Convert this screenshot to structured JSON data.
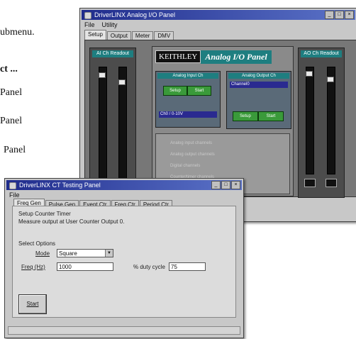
{
  "document": {
    "lines": [
      "ubmenu.",
      "ct ...",
      "Panel",
      "Panel",
      "Panel"
    ]
  },
  "analog_window": {
    "title": "DriverLINX Analog I/O Panel",
    "menu": [
      "File",
      "Utility"
    ],
    "tabs": [
      "Setup",
      "Output",
      "Meter",
      "DMV"
    ],
    "left_panel_header": "AI Ch Readout",
    "right_panel_header": "AO Ch Readout",
    "brand": "KEITHLEY",
    "panel_name": "Analog I/O Panel",
    "input_box_header": "Analog Input Ch",
    "output_box_header": "Analog Output Ch",
    "input_select": "Ch0 / 0-10V",
    "output_select": "Channel0",
    "input_button_1": "Setup",
    "input_button_2": "Start",
    "output_button_1": "Setup",
    "output_button_2": "Start",
    "lower_notes": [
      "Analog input channels",
      "Analog output channels",
      "Digital channels",
      "Counter/timer channels"
    ]
  },
  "counter_window": {
    "title": "DriverLINX CT Testing Panel",
    "menu": [
      "File"
    ],
    "tabs": [
      "Freq Gen",
      "Pulse Gen",
      "Event Ctr",
      "Freq Ctr",
      "Period Ctr"
    ],
    "setup_heading": "Setup Counter Timer",
    "setup_desc": "Measure output at User Counter Output 0.",
    "options_heading": "Select Options",
    "mode_label": "Mode",
    "mode_value": "Square",
    "freq_label": "Freq (Hz)",
    "freq_value": "1000",
    "duty_label": "% duty cycle",
    "duty_value": "75",
    "start_label": "Start"
  },
  "icons": {
    "minimize": "minimize-icon",
    "maximize": "maximize-icon",
    "close": "close-icon",
    "dropdown": "chevron-down-icon"
  },
  "colors": {
    "titlebar_start": "#202c8c",
    "titlebar_end": "#5b73c8",
    "teal_header": "#1e7e80",
    "green_button": "#3a9a3a",
    "panel_gray": "#777777"
  }
}
